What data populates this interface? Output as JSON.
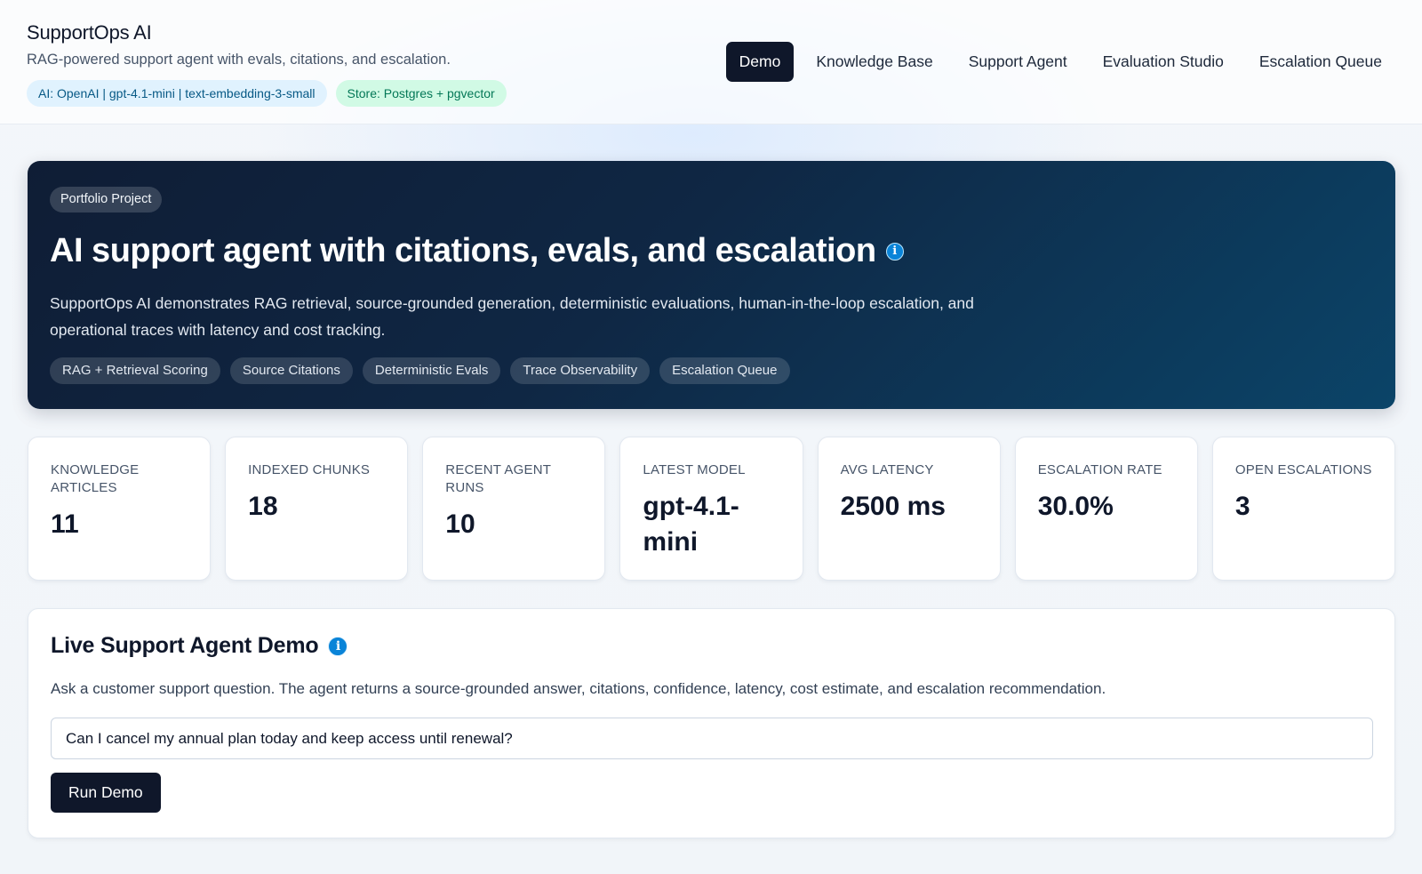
{
  "header": {
    "title": "SupportOps AI",
    "subtitle": "RAG-powered support agent with evals, citations, and escalation.",
    "ai_pill": "AI: OpenAI | gpt-4.1-mini | text-embedding-3-small",
    "store_pill": "Store: Postgres + pgvector"
  },
  "nav": {
    "items": [
      {
        "label": "Demo",
        "active": true
      },
      {
        "label": "Knowledge Base"
      },
      {
        "label": "Support Agent"
      },
      {
        "label": "Evaluation Studio"
      },
      {
        "label": "Escalation Queue"
      }
    ]
  },
  "hero": {
    "badge": "Portfolio Project",
    "title": "AI support agent with citations, evals, and escalation",
    "info_icon": "i",
    "description": "SupportOps AI demonstrates RAG retrieval, source-grounded generation, deterministic evaluations, human-in-the-loop escalation, and operational traces with latency and cost tracking.",
    "tags": [
      "RAG + Retrieval Scoring",
      "Source Citations",
      "Deterministic Evals",
      "Trace Observability",
      "Escalation Queue"
    ]
  },
  "stats": [
    {
      "label": "Knowledge Articles",
      "value": "11"
    },
    {
      "label": "Indexed Chunks",
      "value": "18"
    },
    {
      "label": "Recent Agent Runs",
      "value": "10"
    },
    {
      "label": "Latest Model",
      "value": "gpt-4.1-mini"
    },
    {
      "label": "Avg Latency",
      "value": "2500 ms"
    },
    {
      "label": "Escalation Rate",
      "value": "30.0%"
    },
    {
      "label": "Open Escalations",
      "value": "3"
    }
  ],
  "demo": {
    "title": "Live Support Agent Demo",
    "info_icon": "i",
    "description": "Ask a customer support question. The agent returns a source-grounded answer, citations, confidence, latency, cost estimate, and escalation recommendation.",
    "question_value": "Can I cancel my annual plan today and keep access until renewal?",
    "run_label": "Run Demo"
  },
  "colors": {
    "primary_dark": "#0f172a",
    "hero_gradient_start": "#0f1d35",
    "hero_gradient_end": "#0b4468",
    "info_blue": "#0a84d8",
    "ai_pill_bg": "#e0f2fe",
    "store_pill_bg": "#d1fae5"
  }
}
